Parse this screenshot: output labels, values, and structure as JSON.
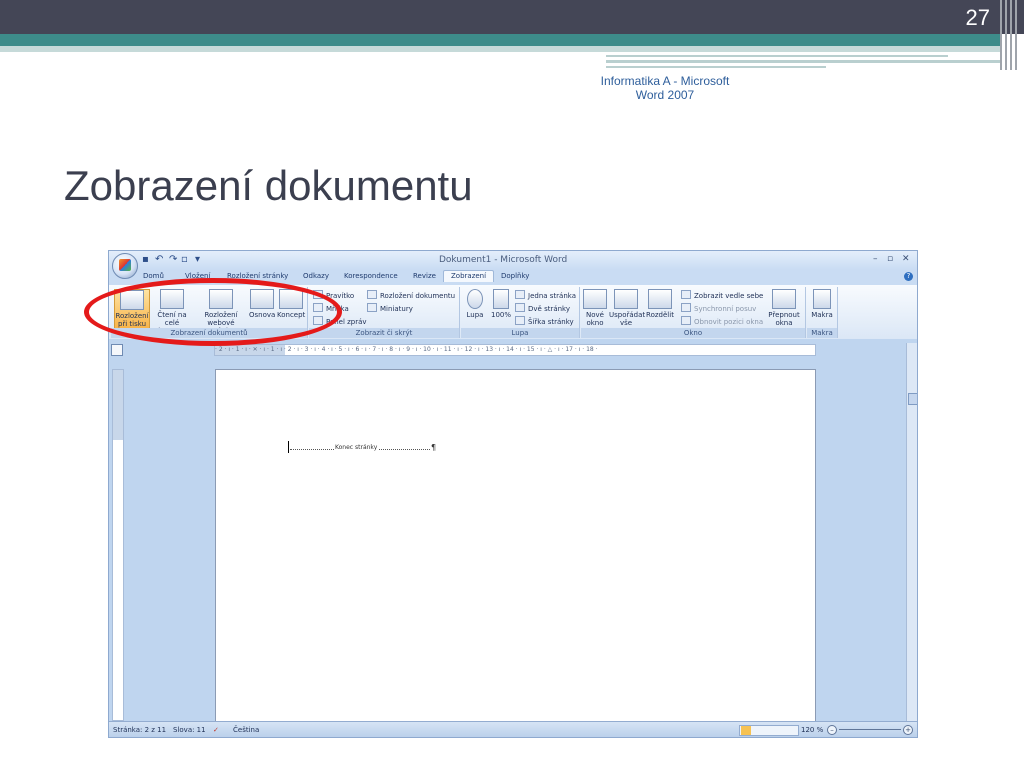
{
  "slide": {
    "number": "27",
    "header": "Informatika A - Microsoft Word 2007",
    "title": "Zobrazení dokumentu"
  },
  "word": {
    "window_title": "Dokument1 - Microsoft Word",
    "tabs": [
      "Domů",
      "Vložení",
      "Rozložení stránky",
      "Odkazy",
      "Korespondence",
      "Revize",
      "Zobrazení",
      "Doplňky"
    ],
    "active_tab": "Zobrazení",
    "groups": {
      "views": {
        "label": "Zobrazení dokumentů",
        "buttons": [
          "Rozložení při tisku",
          "Čtení na celé obrazovce",
          "Rozložení webové stránky",
          "Osnova",
          "Koncept"
        ]
      },
      "show": {
        "label": "Zobrazit či skrýt",
        "items": [
          "Pravítko",
          "Mřížka",
          "Panel zpráv",
          "Rozložení dokumentu",
          "Miniatury"
        ]
      },
      "zoom": {
        "label": "Lupa",
        "buttons": [
          "Lupa",
          "100%"
        ],
        "items": [
          "Jedna stránka",
          "Dvě stránky",
          "Šířka stránky"
        ]
      },
      "window": {
        "label": "Okno",
        "buttons": [
          "Nové okno",
          "Uspořádat vše",
          "Rozdělit",
          "Přepnout okna"
        ],
        "items": [
          "Zobrazit vedle sebe",
          "Synchronní posuv",
          "Obnovit pozici okna"
        ]
      },
      "macros": {
        "label": "Makra",
        "buttons": [
          "Makra"
        ]
      }
    },
    "ruler_text": "· 2 · ı · 1 · ı · ✕ · ı · 1 · ı · 2 · ı · 3 · ı · 4 · ı · 5 · ı · 6 · ı · 7 · ı · 8 · ı · 9 · ı · 10 · ı · 11 · ı · 12 · ı · 13 · ı · 14 · ı · 15 · ı · △ · ı · 17 · ı · 18 ·",
    "page_break": "Konec stránky",
    "pilcrow": "¶",
    "status": {
      "page": "Stránka: 2 z 11",
      "words": "Slova: 11",
      "language": "Čeština",
      "zoom": "120 %"
    }
  },
  "colors": {
    "highlight": "#e41a1a",
    "accent": "#3d8c8a",
    "dark": "#444656"
  }
}
